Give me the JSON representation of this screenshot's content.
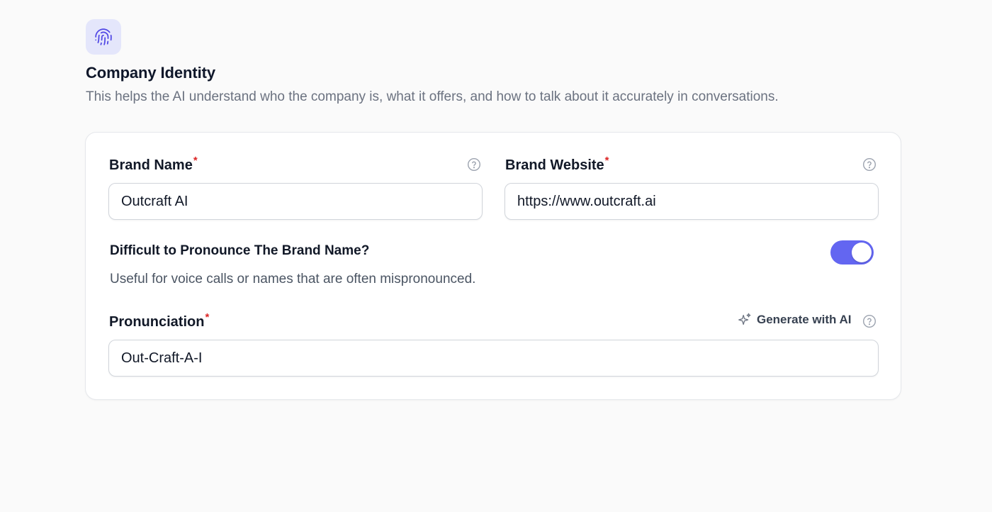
{
  "header": {
    "icon": "fingerprint-icon",
    "title": "Company Identity",
    "description": "This helps the AI understand who the company is, what it offers, and how to talk about it accurately in conversations."
  },
  "form": {
    "brand_name": {
      "label": "Brand Name",
      "required_mark": "*",
      "value": "Outcraft AI",
      "help_icon": "help-circle-icon"
    },
    "brand_website": {
      "label": "Brand Website",
      "required_mark": "*",
      "value": "https://www.outcraft.ai",
      "help_icon": "help-circle-icon"
    },
    "pronounce_toggle": {
      "label": "Difficult to Pronounce The Brand Name?",
      "description": "Useful for voice calls or names that are often mispronounced.",
      "enabled": true
    },
    "pronunciation": {
      "label": "Pronunciation",
      "required_mark": "*",
      "value": "Out-Craft-A-I",
      "generate_label": "Generate with AI",
      "generate_icon": "sparkle-icon",
      "help_icon": "help-circle-icon"
    }
  },
  "colors": {
    "accent": "#6366f1",
    "icon_bg": "#e4e6fb",
    "required": "#dc2626",
    "muted_text": "#6b7280"
  }
}
